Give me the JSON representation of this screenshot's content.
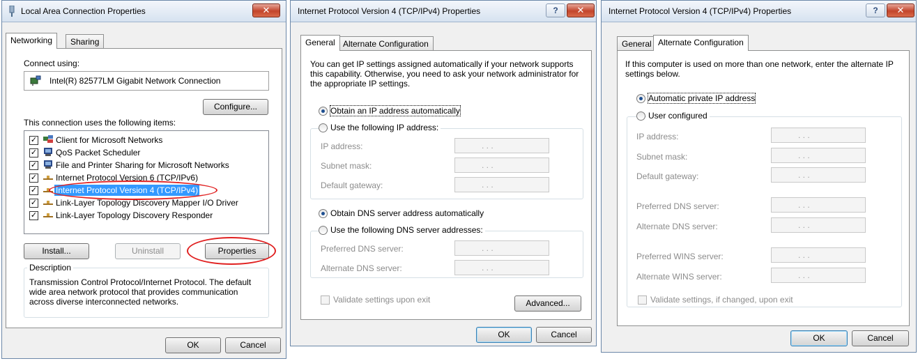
{
  "dialog1": {
    "title": "Local Area Connection Properties",
    "tabs": [
      {
        "label": "Networking"
      },
      {
        "label": "Sharing"
      }
    ],
    "connect_using_label": "Connect using:",
    "adapter": "Intel(R) 82577LM Gigabit Network Connection",
    "configure_button": "Configure...",
    "items_label": "This connection uses the following items:",
    "items": [
      {
        "label": "Client for Microsoft Networks",
        "checked": true,
        "icon": "network-client-icon"
      },
      {
        "label": "QoS Packet Scheduler",
        "checked": true,
        "icon": "computer-icon"
      },
      {
        "label": "File and Printer Sharing for Microsoft Networks",
        "checked": true,
        "icon": "computer-icon"
      },
      {
        "label": "Internet Protocol Version 6 (TCP/IPv6)",
        "checked": true,
        "icon": "protocol-icon"
      },
      {
        "label": "Internet Protocol Version 4 (TCP/IPv4)",
        "checked": true,
        "icon": "protocol-icon",
        "selected": true
      },
      {
        "label": "Link-Layer Topology Discovery Mapper I/O Driver",
        "checked": true,
        "icon": "protocol-icon"
      },
      {
        "label": "Link-Layer Topology Discovery Responder",
        "checked": true,
        "icon": "protocol-icon"
      }
    ],
    "install_button": "Install...",
    "uninstall_button": "Uninstall",
    "properties_button": "Properties",
    "description_label": "Description",
    "description_text": "Transmission Control Protocol/Internet Protocol. The default wide area network protocol that provides communication across diverse interconnected networks.",
    "ok_button": "OK",
    "cancel_button": "Cancel",
    "highlight_color": "#e02020"
  },
  "dialog2": {
    "title": "Internet Protocol Version 4 (TCP/IPv4) Properties",
    "tabs": [
      {
        "label": "General"
      },
      {
        "label": "Alternate Configuration"
      }
    ],
    "intro": "You can get IP settings assigned automatically if your network supports this capability. Otherwise, you need to ask your network administrator for the appropriate IP settings.",
    "obtain_ip_auto": "Obtain an IP address automatically",
    "use_following_ip": "Use the following IP address:",
    "ip_address_label": "IP address:",
    "subnet_mask_label": "Subnet mask:",
    "default_gateway_label": "Default gateway:",
    "obtain_dns_auto": "Obtain DNS server address automatically",
    "use_following_dns": "Use the following DNS server addresses:",
    "preferred_dns_label": "Preferred DNS server:",
    "alternate_dns_label": "Alternate DNS server:",
    "validate_label": "Validate settings upon exit",
    "advanced_button": "Advanced...",
    "ok_button": "OK",
    "cancel_button": "Cancel",
    "ip_placeholder": ".  .  ."
  },
  "dialog3": {
    "title": "Internet Protocol Version 4 (TCP/IPv4) Properties",
    "tabs": [
      {
        "label": "General"
      },
      {
        "label": "Alternate Configuration"
      }
    ],
    "intro": "If this computer is used on more than one network, enter the alternate IP settings below.",
    "automatic_private_ip": "Automatic private IP address",
    "user_configured": "User configured",
    "ip_address_label": "IP address:",
    "subnet_mask_label": "Subnet mask:",
    "default_gateway_label": "Default gateway:",
    "preferred_dns_label": "Preferred DNS server:",
    "alternate_dns_label": "Alternate DNS server:",
    "preferred_wins_label": "Preferred WINS server:",
    "alternate_wins_label": "Alternate WINS server:",
    "validate_label": "Validate settings, if changed, upon exit",
    "ok_button": "OK",
    "cancel_button": "Cancel",
    "ip_placeholder": ".  .  ."
  }
}
